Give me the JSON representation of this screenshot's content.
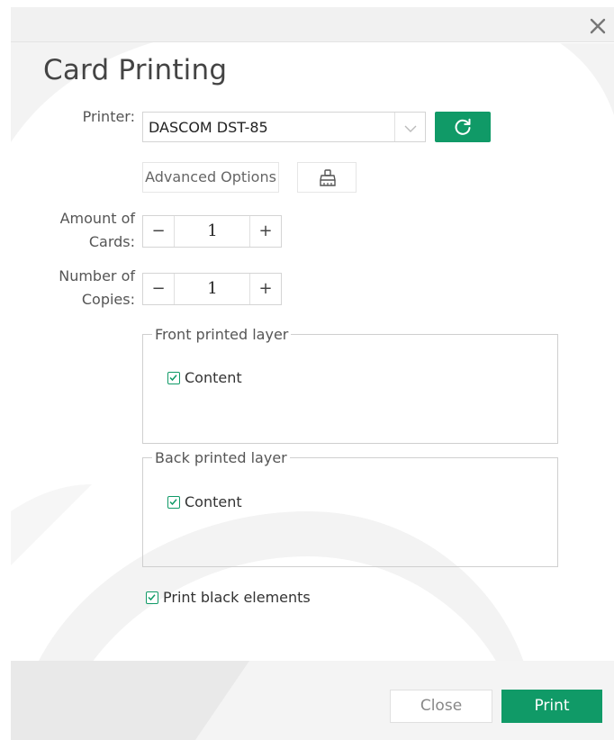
{
  "dialog": {
    "title": "Card Printing",
    "close_icon": "close-icon"
  },
  "printer": {
    "label": "Printer:",
    "selected": "DASCOM DST-85",
    "refresh_icon": "refresh-icon"
  },
  "advanced": {
    "label": "Advanced Options",
    "clean_icon": "brush-icon"
  },
  "amount": {
    "label_line1": "Amount of",
    "label_line2": "Cards:",
    "value": "1",
    "minus": "−",
    "plus": "+"
  },
  "copies": {
    "label_line1": "Number of",
    "label_line2": "Copies:",
    "value": "1",
    "minus": "−",
    "plus": "+"
  },
  "front_layer": {
    "legend": "Front printed layer",
    "content_label": "Content",
    "content_checked": true
  },
  "back_layer": {
    "legend": "Back printed layer",
    "content_label": "Content",
    "content_checked": true
  },
  "print_black": {
    "label": "Print black elements",
    "checked": true
  },
  "footer": {
    "close_label": "Close",
    "print_label": "Print"
  },
  "colors": {
    "accent": "#109a67",
    "topbar": "#f1f1f1",
    "footer": "#f4f4f4"
  }
}
